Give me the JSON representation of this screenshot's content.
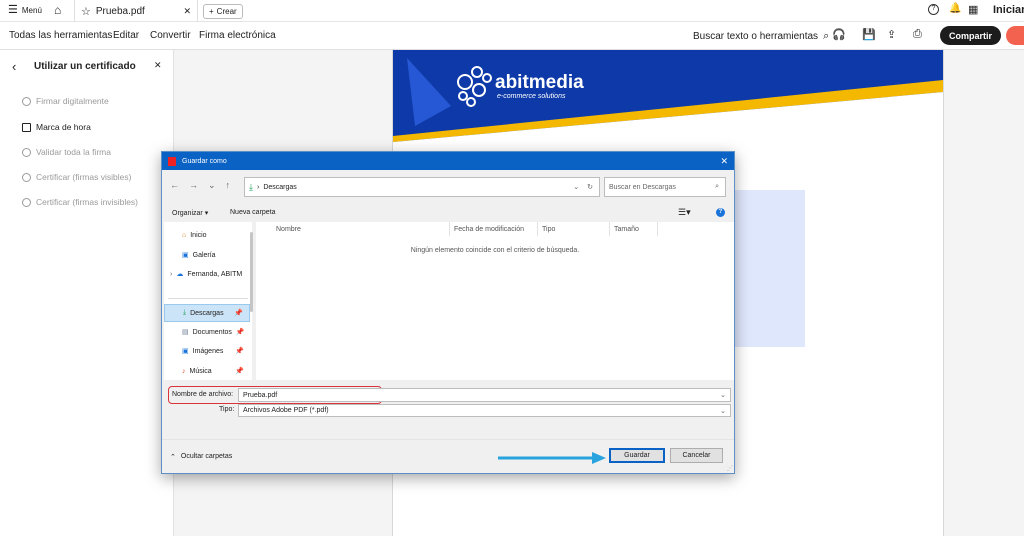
{
  "topbar": {
    "menu_label": "Menú",
    "tab_title": "Prueba.pdf",
    "create_label": "Crear",
    "signin_label": "Iniciar"
  },
  "toolbar": {
    "tabs": [
      "Todas las herramientas",
      "Editar",
      "Convertir",
      "Firma electrónica"
    ],
    "search_label": "Buscar texto o herramientas",
    "share_label": "Compartir"
  },
  "left_panel": {
    "title": "Utilizar un certificado",
    "items": [
      {
        "label": "Firmar digitalmente",
        "active": false
      },
      {
        "label": "Marca de hora",
        "active": true
      },
      {
        "label": "Validar toda la firma",
        "active": false
      },
      {
        "label": "Certificar (firmas visibles)",
        "active": false
      },
      {
        "label": "Certificar (firmas invisibles)",
        "active": false
      }
    ]
  },
  "document": {
    "brand_name": "abitmedia",
    "brand_tagline": "e-commerce solutions",
    "colors": {
      "banner": "#0d3aa8",
      "accent": "#f5b800",
      "highlight": "#dfe7fd"
    }
  },
  "dialog": {
    "title": "Guardar como",
    "path_folder": "Descargas",
    "search_placeholder": "Buscar en Descargas",
    "organize_label": "Organizar",
    "new_folder_label": "Nueva carpeta",
    "nav_items": [
      {
        "label": "Inicio",
        "icon": "home-icon"
      },
      {
        "label": "Galería",
        "icon": "gallery-icon"
      },
      {
        "label": "Fernanda, ABITM",
        "icon": "cloud-icon"
      },
      {
        "label": "Descargas",
        "icon": "download-icon"
      },
      {
        "label": "Documentos",
        "icon": "document-icon"
      },
      {
        "label": "Imágenes",
        "icon": "image-icon"
      },
      {
        "label": "Música",
        "icon": "music-icon"
      }
    ],
    "columns": [
      "Nombre",
      "Fecha de modificación",
      "Tipo",
      "Tamaño"
    ],
    "empty_message": "Ningún elemento coincide con el criterio de búsqueda.",
    "filename_label": "Nombre de archivo:",
    "filename_value": "Prueba.pdf",
    "type_label": "Tipo:",
    "type_value": "Archivos Adobe PDF (*.pdf)",
    "hide_folders_label": "Ocultar carpetas",
    "save_label": "Guardar",
    "cancel_label": "Cancelar"
  }
}
